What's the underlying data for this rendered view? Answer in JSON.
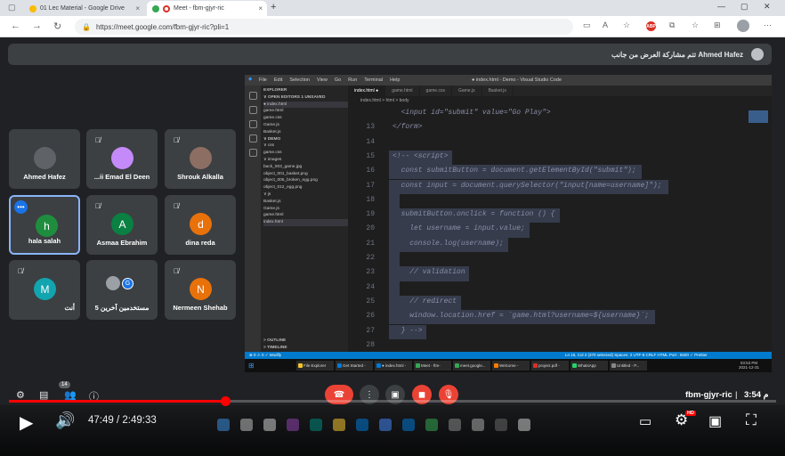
{
  "browser": {
    "tabs": [
      {
        "label": "01 Lec Material - Google Drive",
        "close": "×"
      },
      {
        "label": "Meet - fbm-gjyr-ric",
        "close": "×"
      }
    ],
    "new_tab": "+",
    "window_controls": [
      "—",
      "▢",
      "✕"
    ],
    "url": "https://meet.google.com/fbm-gjyr-ric?pli=1",
    "adblock_badge": "ABP"
  },
  "meet": {
    "banner": {
      "text": "تتم مشاركة العرض من جانب Ahmed Hafez"
    },
    "participants": [
      {
        "name": "Ahmed Hafez",
        "initial": "",
        "color": "#5f6368",
        "muted": false
      },
      {
        "name": "...ii Emad El Deen",
        "initial": "",
        "color": "#c58af9",
        "muted": true
      },
      {
        "name": "Shrouk Alkalla",
        "initial": "",
        "color": "#8d6e63",
        "muted": true
      },
      {
        "name": "hala salah",
        "initial": "h",
        "color": "#1e8e3e",
        "muted": false,
        "more": "•••"
      },
      {
        "name": "Asmaa Ebrahim",
        "initial": "A",
        "color": "#0b8043",
        "muted": true
      },
      {
        "name": "dina reda",
        "initial": "d",
        "color": "#e8710a",
        "muted": true
      },
      {
        "name": "أنت",
        "initial": "M",
        "color": "#12a4af",
        "muted": true
      },
      {
        "name": "5 مستخدمين آخرين",
        "initial": "G",
        "color": "#1a73e8",
        "muted": false
      },
      {
        "name": "Nermeen Shehab",
        "initial": "N",
        "color": "#e8710a",
        "muted": true
      }
    ],
    "people_count": "14",
    "meeting_code": "fbm-gjyr-ric",
    "meeting_time": "3:54 م"
  },
  "vscode": {
    "menu": [
      "File",
      "Edit",
      "Selection",
      "View",
      "Go",
      "Run",
      "Terminal",
      "Help"
    ],
    "title": "● index.html - Demo - Visual Studio Code",
    "explorer": [
      {
        "text": "EXPLORER",
        "cls": "hdr"
      },
      {
        "text": "∨ OPEN EDITORS   1 UNSAVED",
        "cls": "hdr"
      },
      {
        "text": "   ● index.html",
        "cls": "hl"
      },
      {
        "text": "      game.html",
        "cls": ""
      },
      {
        "text": "      game.css",
        "cls": ""
      },
      {
        "text": "      Game.js",
        "cls": ""
      },
      {
        "text": "      Basket.js",
        "cls": ""
      },
      {
        "text": "∨ DEMO",
        "cls": "hdr"
      },
      {
        "text": "  ∨ css",
        "cls": ""
      },
      {
        "text": "      game.css",
        "cls": ""
      },
      {
        "text": "  ∨ images",
        "cls": ""
      },
      {
        "text": "      back_003_game.jpg",
        "cls": ""
      },
      {
        "text": "      object_001_basket.png",
        "cls": ""
      },
      {
        "text": "      object_005_broken_egg.png",
        "cls": ""
      },
      {
        "text": "      object_012_egg.png",
        "cls": ""
      },
      {
        "text": "  ∨ js",
        "cls": ""
      },
      {
        "text": "      Basket.js",
        "cls": ""
      },
      {
        "text": "      Game.js",
        "cls": ""
      },
      {
        "text": "    game.html",
        "cls": ""
      },
      {
        "text": "    index.html",
        "cls": "hl"
      }
    ],
    "outline": "> OUTLINE",
    "timeline": "> TIMELINE",
    "tabs": [
      {
        "label": "index.html ●",
        "active": true
      },
      {
        "label": "game.html",
        "active": false
      },
      {
        "label": "game.css",
        "active": false
      },
      {
        "label": "Game.js",
        "active": false
      },
      {
        "label": "Basket.js",
        "active": false
      }
    ],
    "breadcrumb": "index.html > html > body",
    "code_lines": [
      {
        "n": "",
        "t": "  <input id=\"submit\" value=\"Go Play\">",
        "sel": false
      },
      {
        "n": "13",
        "t": "</form>",
        "sel": false
      },
      {
        "n": "14",
        "t": "",
        "sel": false
      },
      {
        "n": "15",
        "t": "<!-- <script>",
        "sel": true
      },
      {
        "n": "16",
        "t": "  const submitButton = document.getElementById(\"submit\");",
        "sel": true
      },
      {
        "n": "17",
        "t": "  const input = document.querySelector(\"input[name=username]\");",
        "sel": true
      },
      {
        "n": "18",
        "t": "",
        "sel": true
      },
      {
        "n": "19",
        "t": "  submitButton.onclick = function () {",
        "sel": true
      },
      {
        "n": "20",
        "t": "    let username = input.value;",
        "sel": true
      },
      {
        "n": "21",
        "t": "    console.log(username);",
        "sel": true
      },
      {
        "n": "22",
        "t": "",
        "sel": true
      },
      {
        "n": "23",
        "t": "    // validation",
        "sel": true
      },
      {
        "n": "24",
        "t": "",
        "sel": true
      },
      {
        "n": "25",
        "t": "    // redirect",
        "sel": true
      },
      {
        "n": "26",
        "t": "    window.location.href = `game.html?username=${username}`;",
        "sel": true
      },
      {
        "n": "27",
        "t": "  } -->",
        "sel": true
      },
      {
        "n": "28",
        "t": "",
        "sel": false
      }
    ],
    "status_left": "⊗ 0 ⚠ 0   ✓ Modify",
    "status_right": "Ln 15, Col 2 (370 selected)   Spaces: 2   UTF-8   CRLF   HTML   Port : 5500   ✓ Prettier"
  },
  "windows_taskbar": {
    "items": [
      {
        "label": "File Explorer",
        "color": "#f4c430"
      },
      {
        "label": "Get Started -",
        "color": "#0078d4"
      },
      {
        "label": "● index.html -",
        "color": "#0078d4"
      },
      {
        "label": "Meet - ftm-",
        "color": "#34a853"
      },
      {
        "label": "meet.google...",
        "color": "#34a853"
      },
      {
        "label": "Welcome -",
        "color": "#f57c00"
      },
      {
        "label": "project.pdf -",
        "color": "#d93025"
      },
      {
        "label": "WhatsApp",
        "color": "#25d366"
      },
      {
        "label": "Untitled - P...",
        "color": "#888888"
      }
    ],
    "clock_time": "03:53 PM",
    "clock_date": "2021-12-31"
  },
  "youtube": {
    "current_time": "47:49",
    "duration": "2:49:33",
    "time_display": "47:49 / 2:49:33",
    "played_fraction": 0.282,
    "hd_badge": "HD"
  }
}
